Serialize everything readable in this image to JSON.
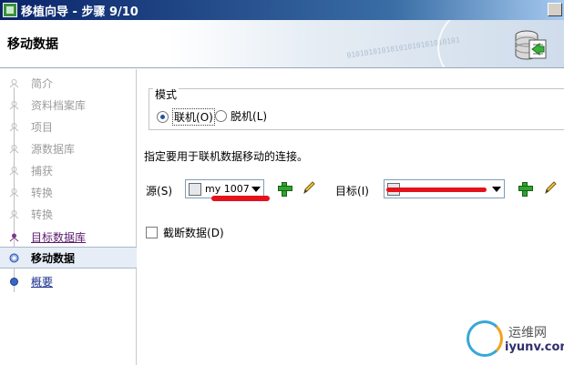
{
  "window": {
    "title": "移植向导 - 步骤 9/10"
  },
  "header": {
    "page_title": "移动数据",
    "binary_deco": "01010101010101010101010101"
  },
  "nav": {
    "items": [
      {
        "label": "简介",
        "state": "disabled"
      },
      {
        "label": "资料档案库",
        "state": "disabled"
      },
      {
        "label": "项目",
        "state": "disabled"
      },
      {
        "label": "源数据库",
        "state": "disabled"
      },
      {
        "label": "捕获",
        "state": "disabled"
      },
      {
        "label": "转换",
        "state": "disabled"
      },
      {
        "label": "转换",
        "state": "disabled"
      },
      {
        "label": "目标数据库",
        "state": "visited"
      },
      {
        "label": "移动数据",
        "state": "current"
      },
      {
        "label": "概要",
        "state": "link"
      }
    ]
  },
  "mode": {
    "legend": "模式",
    "options": [
      {
        "label": "联机",
        "mnemonic": "(O)",
        "selected": true
      },
      {
        "label": "脱机",
        "mnemonic": "(L)",
        "selected": false
      }
    ]
  },
  "instruction": "指定要用于联机数据移动的连接。",
  "source": {
    "label": "源",
    "mnemonic": "(S)",
    "value": "my 1007"
  },
  "target": {
    "label": "目标",
    "mnemonic": "(I)",
    "value": ""
  },
  "truncate": {
    "label": "截断数据",
    "mnemonic": "(D)",
    "checked": false
  },
  "watermark": {
    "line1": "运维网",
    "line2": "iyunv.com"
  },
  "colors": {
    "title_bar": "#0a246a",
    "add_icon": "#2fa32f",
    "redaction": "#e4121a",
    "selection": "#e6edf6"
  }
}
